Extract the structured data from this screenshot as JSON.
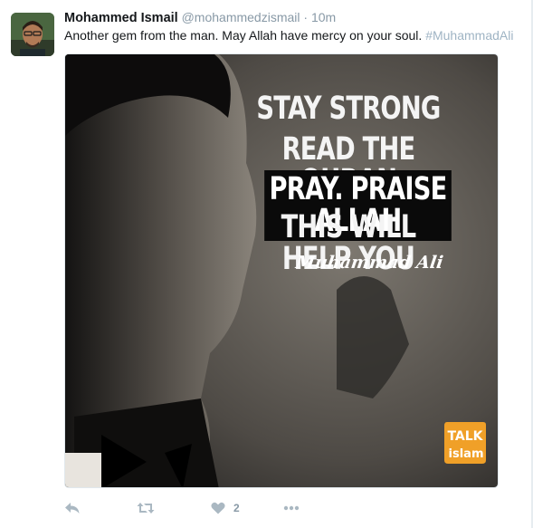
{
  "tweet": {
    "display_name": "Mohammed Ismail",
    "handle": "@mohammedzismail",
    "separator": "·",
    "time": "10m",
    "text": "Another gem from the man. May Allah have mercy on your soul.",
    "hashtag": "#MuhammadAli"
  },
  "media": {
    "line1": "STAY STRONG",
    "line2": "READ THE QURAN",
    "line3": "PRAY. PRAISE ALLAH",
    "line4": "THIS WILL HELP YOU",
    "signature": "Muhammad Ali",
    "logo_top": "TALK",
    "logo_bottom": "islam"
  },
  "actions": {
    "like_count": "2",
    "icons": [
      "reply-icon",
      "retweet-icon",
      "like-icon",
      "more-icon"
    ]
  },
  "colors": {
    "muted": "#8899a6",
    "hashtag": "#9fb4c4",
    "logo_orange": "#f0a028"
  }
}
